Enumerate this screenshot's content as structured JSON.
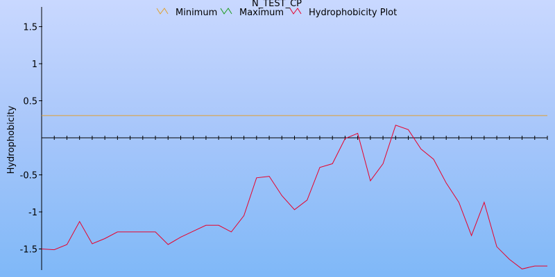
{
  "chart_data": {
    "type": "line",
    "title": "N_TEST_CP",
    "ylabel": "Hydrophobicity",
    "xlabel": "",
    "ylim": [
      -1.75,
      1.75
    ],
    "grid": false,
    "legend_position": "top",
    "y_ticks": [
      1.5,
      1,
      0.5,
      -0.5,
      -1,
      -1.5
    ],
    "y_tick_labels": [
      "1.5",
      "1",
      "0.5",
      "-0.5",
      "-1",
      "-1.5"
    ],
    "x_tick_count": 40,
    "series": [
      {
        "name": "Minimum",
        "color": "#e0a030",
        "x": [
          0,
          1
        ],
        "y": [
          0.3,
          0.3
        ]
      },
      {
        "name": "Maximum",
        "color": "#1a9a1a",
        "x": [],
        "y": []
      },
      {
        "name": "Hydrophobicity Plot",
        "color": "#e8002a",
        "x": [
          0,
          1,
          2,
          3,
          4,
          5,
          6,
          7,
          8,
          9,
          10,
          11,
          12,
          13,
          14,
          15,
          16,
          17,
          18,
          19,
          20,
          21,
          22,
          23,
          24,
          25,
          26,
          27,
          28,
          29,
          30,
          31,
          32,
          33,
          34,
          35,
          36,
          37,
          38,
          39,
          40
        ],
        "y": [
          -1.5,
          -1.51,
          -1.44,
          -1.13,
          -1.43,
          -1.36,
          -1.27,
          -1.27,
          -1.27,
          -1.27,
          -1.44,
          -1.34,
          -1.26,
          -1.18,
          -1.18,
          -1.27,
          -1.05,
          -0.54,
          -0.52,
          -0.78,
          -0.97,
          -0.84,
          -0.4,
          -0.35,
          -0.01,
          0.06,
          -0.58,
          -0.35,
          0.17,
          0.11,
          -0.15,
          -0.29,
          -0.61,
          -0.87,
          -1.32,
          -0.87,
          -1.47,
          -1.64,
          -1.77,
          -1.73,
          -1.73
        ]
      }
    ]
  }
}
